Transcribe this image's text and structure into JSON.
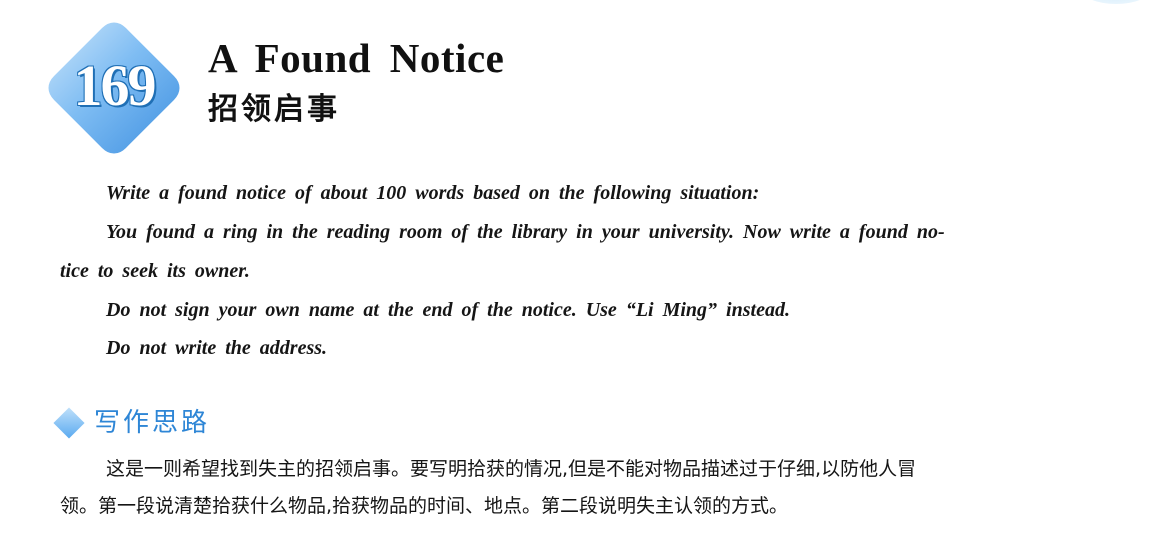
{
  "badge": {
    "number": "169"
  },
  "header": {
    "title_en": "A Found Notice",
    "title_zh": "招领启事"
  },
  "prompt": {
    "lines": [
      "Write a found notice of about 100 words based on the following situation:",
      "You found a ring in the reading room of the library in your university. Now write a found no-",
      "tice to seek its owner.",
      "Do not sign your own name at the end of the notice. Use “Li Ming” instead.",
      "Do not write the address."
    ]
  },
  "section": {
    "title": "写作思路",
    "lines": [
      "这是一则希望找到失主的招领启事。要写明拾获的情况,但是不能对物品描述过于仔细,以防他人冒",
      "领。第一段说清楚拾获什么物品,拾获物品的时间、地点。第二段说明失主认领的方式。"
    ]
  },
  "colors": {
    "badge_light": "#a9d4f7",
    "badge_dark": "#3d8fe0",
    "section_title": "#2e86d6",
    "text": "#151515"
  }
}
